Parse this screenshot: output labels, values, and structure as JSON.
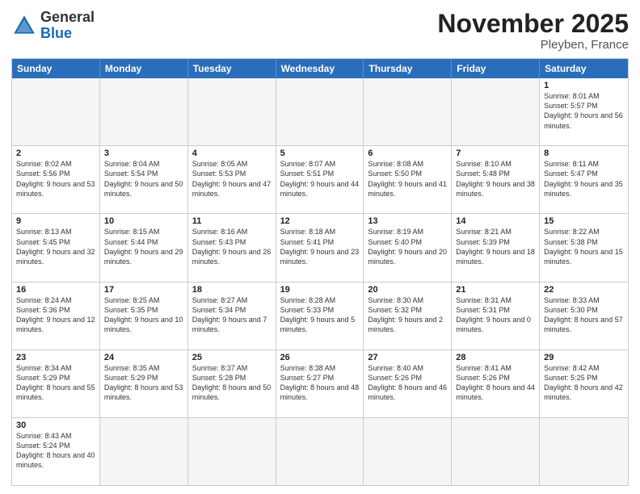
{
  "header": {
    "logo_general": "General",
    "logo_blue": "Blue",
    "title": "November 2025",
    "subtitle": "Pleyben, France"
  },
  "weekdays": [
    "Sunday",
    "Monday",
    "Tuesday",
    "Wednesday",
    "Thursday",
    "Friday",
    "Saturday"
  ],
  "rows": [
    [
      {
        "day": "",
        "info": "",
        "empty": true
      },
      {
        "day": "",
        "info": "",
        "empty": true
      },
      {
        "day": "",
        "info": "",
        "empty": true
      },
      {
        "day": "",
        "info": "",
        "empty": true
      },
      {
        "day": "",
        "info": "",
        "empty": true
      },
      {
        "day": "",
        "info": "",
        "empty": true
      },
      {
        "day": "1",
        "info": "Sunrise: 8:01 AM\nSunset: 5:57 PM\nDaylight: 9 hours\nand 56 minutes."
      }
    ],
    [
      {
        "day": "2",
        "info": "Sunrise: 8:02 AM\nSunset: 5:56 PM\nDaylight: 9 hours\nand 53 minutes."
      },
      {
        "day": "3",
        "info": "Sunrise: 8:04 AM\nSunset: 5:54 PM\nDaylight: 9 hours\nand 50 minutes."
      },
      {
        "day": "4",
        "info": "Sunrise: 8:05 AM\nSunset: 5:53 PM\nDaylight: 9 hours\nand 47 minutes."
      },
      {
        "day": "5",
        "info": "Sunrise: 8:07 AM\nSunset: 5:51 PM\nDaylight: 9 hours\nand 44 minutes."
      },
      {
        "day": "6",
        "info": "Sunrise: 8:08 AM\nSunset: 5:50 PM\nDaylight: 9 hours\nand 41 minutes."
      },
      {
        "day": "7",
        "info": "Sunrise: 8:10 AM\nSunset: 5:48 PM\nDaylight: 9 hours\nand 38 minutes."
      },
      {
        "day": "8",
        "info": "Sunrise: 8:11 AM\nSunset: 5:47 PM\nDaylight: 9 hours\nand 35 minutes."
      }
    ],
    [
      {
        "day": "9",
        "info": "Sunrise: 8:13 AM\nSunset: 5:45 PM\nDaylight: 9 hours\nand 32 minutes."
      },
      {
        "day": "10",
        "info": "Sunrise: 8:15 AM\nSunset: 5:44 PM\nDaylight: 9 hours\nand 29 minutes."
      },
      {
        "day": "11",
        "info": "Sunrise: 8:16 AM\nSunset: 5:43 PM\nDaylight: 9 hours\nand 26 minutes."
      },
      {
        "day": "12",
        "info": "Sunrise: 8:18 AM\nSunset: 5:41 PM\nDaylight: 9 hours\nand 23 minutes."
      },
      {
        "day": "13",
        "info": "Sunrise: 8:19 AM\nSunset: 5:40 PM\nDaylight: 9 hours\nand 20 minutes."
      },
      {
        "day": "14",
        "info": "Sunrise: 8:21 AM\nSunset: 5:39 PM\nDaylight: 9 hours\nand 18 minutes."
      },
      {
        "day": "15",
        "info": "Sunrise: 8:22 AM\nSunset: 5:38 PM\nDaylight: 9 hours\nand 15 minutes."
      }
    ],
    [
      {
        "day": "16",
        "info": "Sunrise: 8:24 AM\nSunset: 5:36 PM\nDaylight: 9 hours\nand 12 minutes."
      },
      {
        "day": "17",
        "info": "Sunrise: 8:25 AM\nSunset: 5:35 PM\nDaylight: 9 hours\nand 10 minutes."
      },
      {
        "day": "18",
        "info": "Sunrise: 8:27 AM\nSunset: 5:34 PM\nDaylight: 9 hours\nand 7 minutes."
      },
      {
        "day": "19",
        "info": "Sunrise: 8:28 AM\nSunset: 5:33 PM\nDaylight: 9 hours\nand 5 minutes."
      },
      {
        "day": "20",
        "info": "Sunrise: 8:30 AM\nSunset: 5:32 PM\nDaylight: 9 hours\nand 2 minutes."
      },
      {
        "day": "21",
        "info": "Sunrise: 8:31 AM\nSunset: 5:31 PM\nDaylight: 9 hours\nand 0 minutes."
      },
      {
        "day": "22",
        "info": "Sunrise: 8:33 AM\nSunset: 5:30 PM\nDaylight: 8 hours\nand 57 minutes."
      }
    ],
    [
      {
        "day": "23",
        "info": "Sunrise: 8:34 AM\nSunset: 5:29 PM\nDaylight: 8 hours\nand 55 minutes."
      },
      {
        "day": "24",
        "info": "Sunrise: 8:35 AM\nSunset: 5:29 PM\nDaylight: 8 hours\nand 53 minutes."
      },
      {
        "day": "25",
        "info": "Sunrise: 8:37 AM\nSunset: 5:28 PM\nDaylight: 8 hours\nand 50 minutes."
      },
      {
        "day": "26",
        "info": "Sunrise: 8:38 AM\nSunset: 5:27 PM\nDaylight: 8 hours\nand 48 minutes."
      },
      {
        "day": "27",
        "info": "Sunrise: 8:40 AM\nSunset: 5:26 PM\nDaylight: 8 hours\nand 46 minutes."
      },
      {
        "day": "28",
        "info": "Sunrise: 8:41 AM\nSunset: 5:26 PM\nDaylight: 8 hours\nand 44 minutes."
      },
      {
        "day": "29",
        "info": "Sunrise: 8:42 AM\nSunset: 5:25 PM\nDaylight: 8 hours\nand 42 minutes."
      }
    ],
    [
      {
        "day": "30",
        "info": "Sunrise: 8:43 AM\nSunset: 5:24 PM\nDaylight: 8 hours\nand 40 minutes."
      },
      {
        "day": "",
        "info": "",
        "empty": true
      },
      {
        "day": "",
        "info": "",
        "empty": true
      },
      {
        "day": "",
        "info": "",
        "empty": true
      },
      {
        "day": "",
        "info": "",
        "empty": true
      },
      {
        "day": "",
        "info": "",
        "empty": true
      },
      {
        "day": "",
        "info": "",
        "empty": true
      }
    ]
  ]
}
